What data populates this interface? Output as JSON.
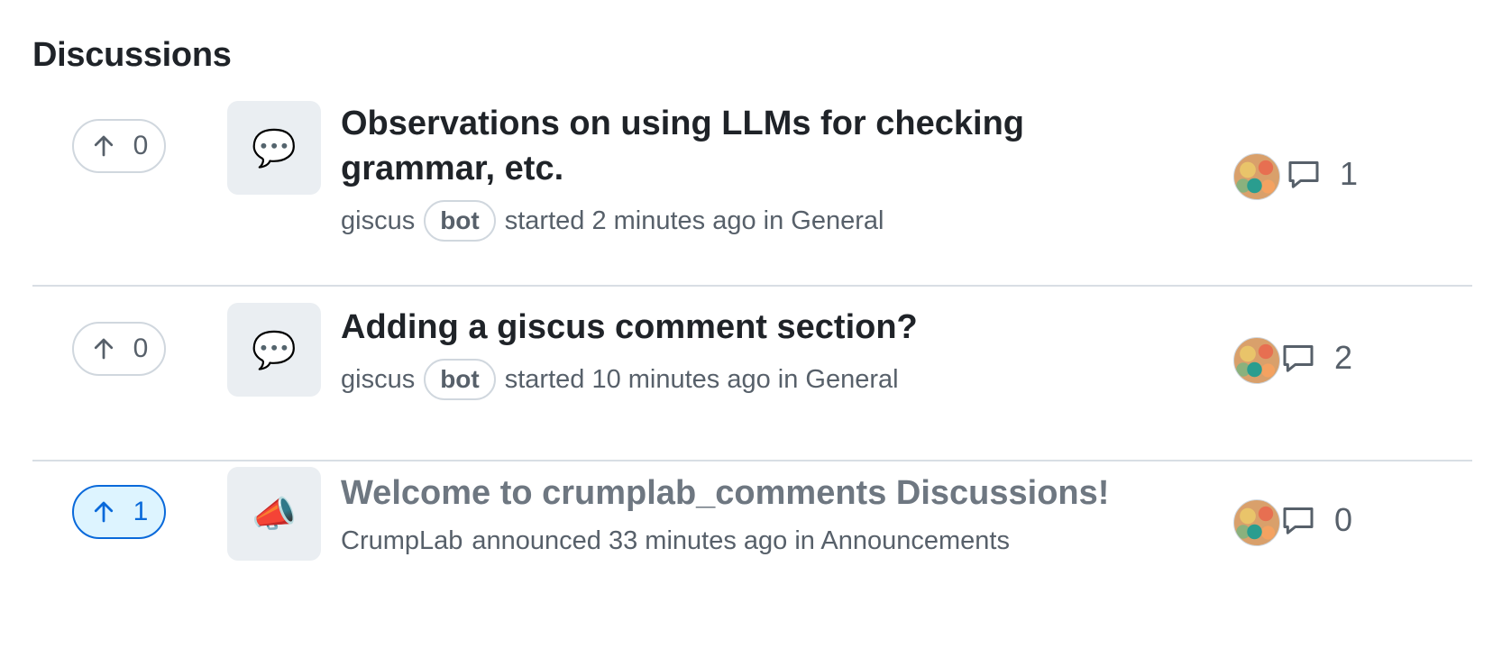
{
  "section_title": "Discussions",
  "discussions": [
    {
      "upvotes": "0",
      "emoji": "💬",
      "title_line1": "Observations on using LLMs for checking",
      "title_line2": "grammar, etc.",
      "author": "giscus",
      "badge": "bot",
      "action": "started 2 minutes ago in General",
      "comments": "1"
    },
    {
      "upvotes": "0",
      "emoji": "💬",
      "title": "Adding a giscus comment section?",
      "author": "giscus",
      "badge": "bot",
      "action": "started 10 minutes ago in General",
      "comments": "2"
    },
    {
      "upvotes": "1",
      "emoji": "📣",
      "title": "Welcome to crumplab_comments Discussions!",
      "author": "CrumpLab",
      "action": "announced 33 minutes ago in Announcements",
      "comments": "0"
    }
  ]
}
